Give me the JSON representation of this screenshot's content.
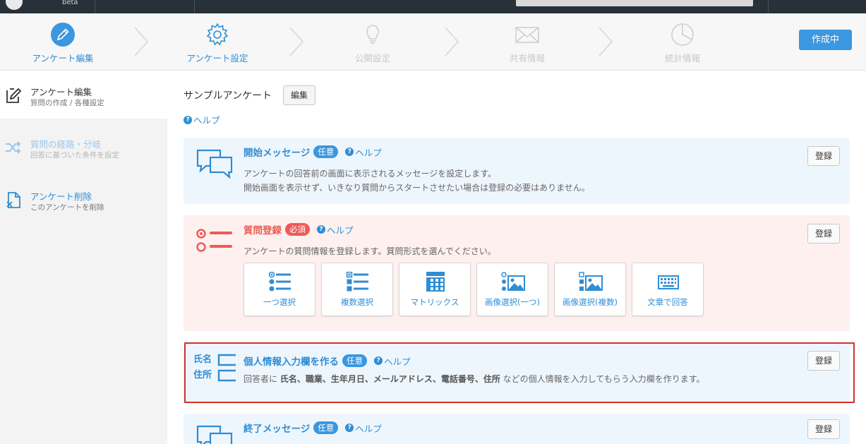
{
  "topbar": {
    "beta": "beta"
  },
  "steps": [
    {
      "label": "アンケート編集",
      "icon": "pencil-icon",
      "state": "active"
    },
    {
      "label": "アンケート設定",
      "icon": "gear-icon",
      "state": "done"
    },
    {
      "label": "公開設定",
      "icon": "lightbulb-icon",
      "state": "disabled"
    },
    {
      "label": "共有情報",
      "icon": "envelope-icon",
      "state": "disabled"
    },
    {
      "label": "統計情報",
      "icon": "pie-chart-icon",
      "state": "disabled"
    }
  ],
  "status_button": "作成中",
  "sidebar": {
    "items": [
      {
        "title": "アンケート編集",
        "sub": "質問の作成 / 各種設定"
      },
      {
        "title": "質問の経路・分岐",
        "sub": "回答に基づいた条件を設定"
      },
      {
        "title": "アンケート削除",
        "sub": "このアンケートを削除"
      }
    ]
  },
  "main": {
    "survey_title": "サンプルアンケート",
    "edit_label": "編集",
    "help_label": "ヘルプ",
    "register_label": "登録",
    "optional_badge": "任意",
    "required_badge": "必須",
    "cards": {
      "start": {
        "title": "開始メッセージ",
        "line1": "アンケートの回答前の画面に表示されるメッセージを設定します。",
        "line2": "開始画面を表示せず、いきなり質問からスタートさせたい場合は登録の必要はありません。"
      },
      "questions": {
        "title": "質問登録",
        "line1": "アンケートの質問情報を登録します。質問形式を選んでください。",
        "types": [
          "一つ選択",
          "複数選択",
          "マトリックス",
          "画像選択(一つ)",
          "画像選択(複数)",
          "文章で回答"
        ]
      },
      "personal": {
        "title": "個人情報入力欄を作る",
        "left_label_1": "氏名",
        "left_label_2": "住所",
        "desc_pre": "回答者に ",
        "desc_bold": "氏名、職業、生年月日、メールアドレス、電話番号、住所",
        "desc_post": " などの個人情報を入力してもらう入力欄を作ります。"
      },
      "end": {
        "title": "終了メッセージ"
      }
    }
  },
  "colors": {
    "accent": "#2f8dd4",
    "danger": "#ec5b56",
    "highlight": "#d32f2f"
  }
}
